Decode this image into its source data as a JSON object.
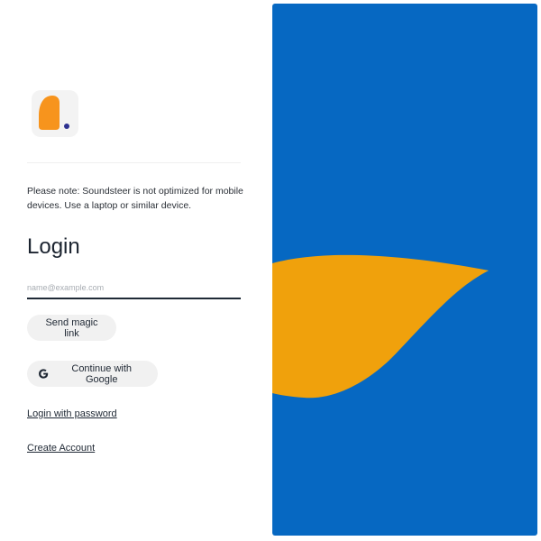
{
  "login_panel": {
    "logo_icon": "soundsteer-logo-icon",
    "notice": "Please note: Soundsteer is not optimized for mobile devices. Use a laptop or similar device.",
    "title": "Login",
    "email_placeholder": "name@example.com",
    "email_value": "",
    "magic_link_label": "Send magic link",
    "google_label": "Continue with Google",
    "google_icon": "google-g-icon",
    "password_link": "Login with password",
    "create_account_link": "Create Account"
  },
  "hero": {
    "background_color": "#0668c2",
    "shape_color": "#f0a10c"
  },
  "colors": {
    "logo_orange": "#f7941d",
    "logo_dot": "#2d3190",
    "input_underline": "#1f2a36",
    "button_bg": "#f1f1f1"
  }
}
